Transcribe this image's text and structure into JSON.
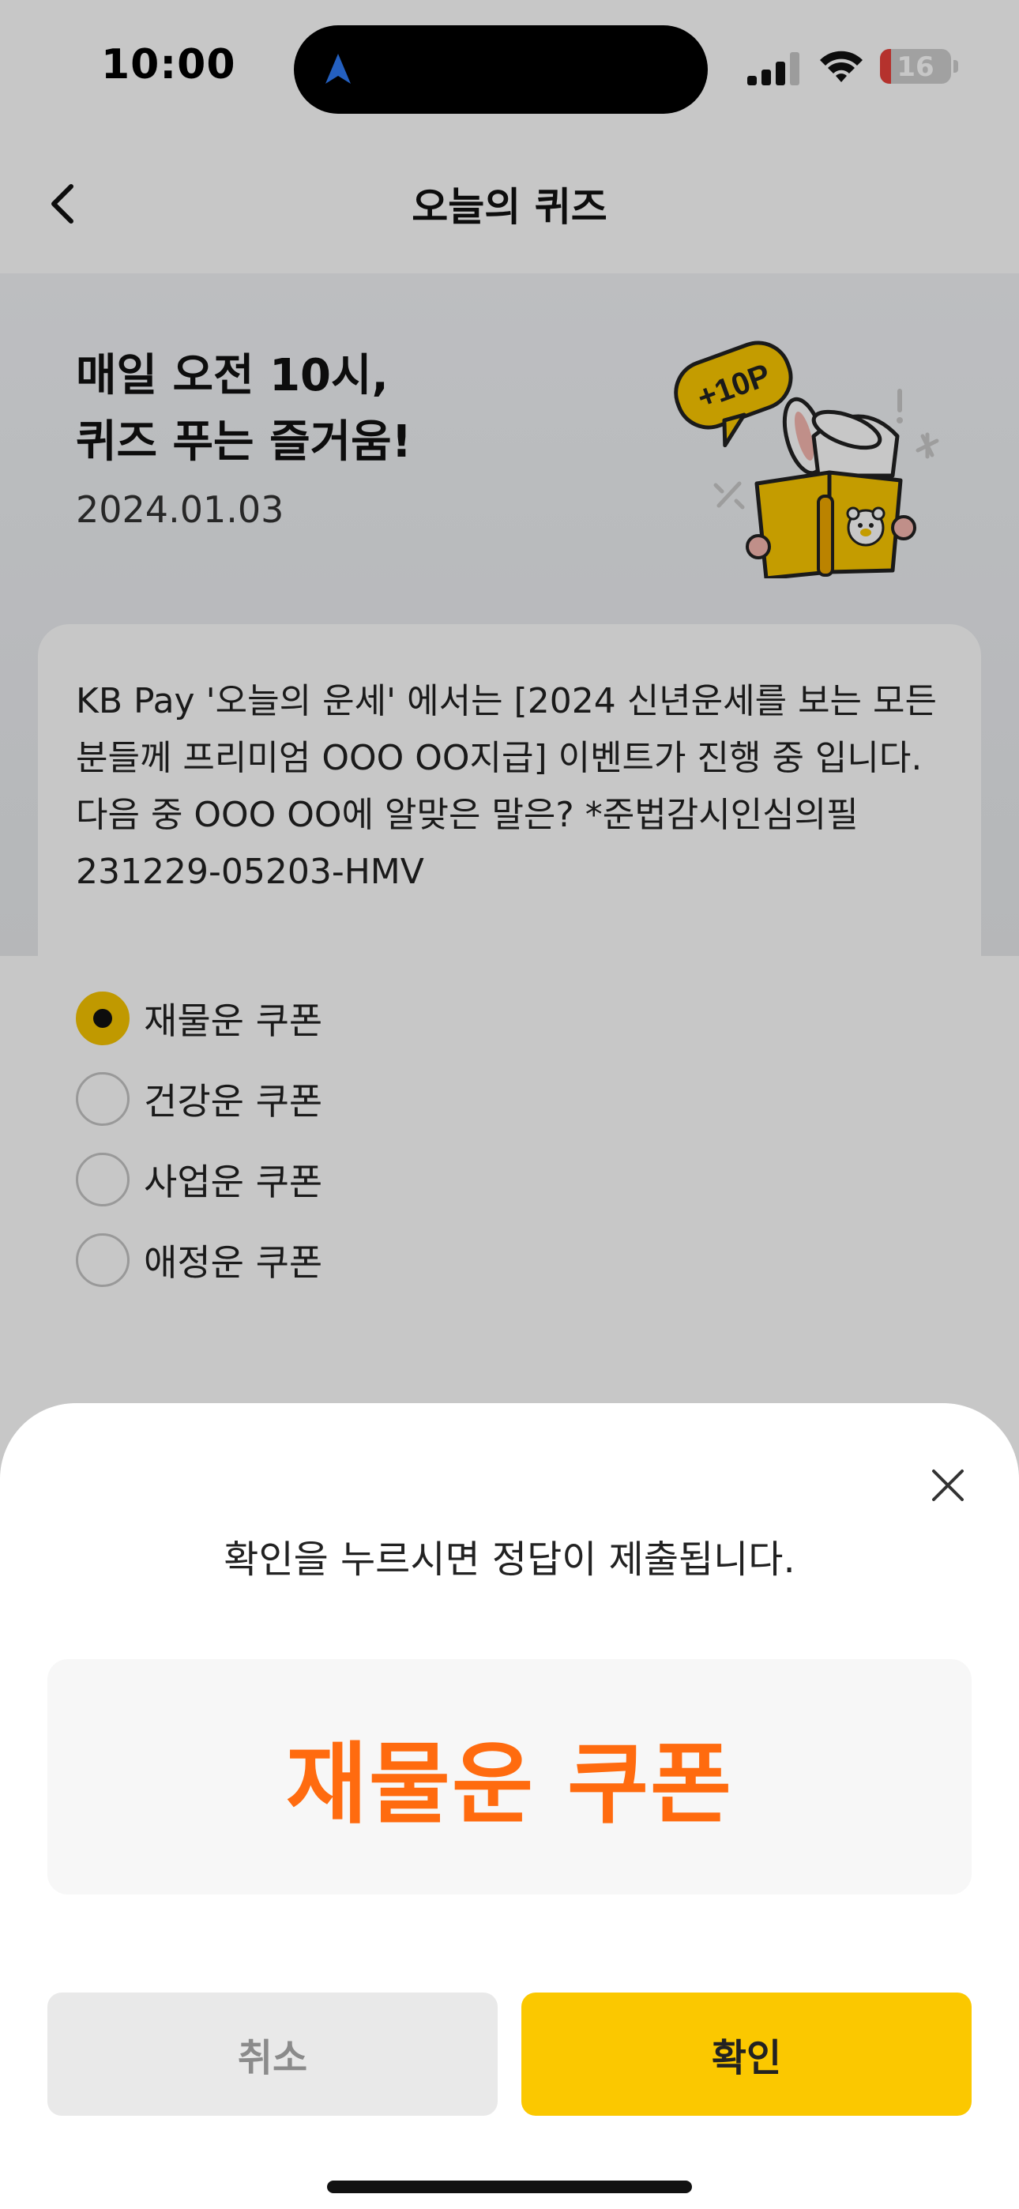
{
  "status_bar": {
    "time": "10:00",
    "battery": "16",
    "battery_level_percent": 16
  },
  "nav": {
    "title": "오늘의 퀴즈",
    "back_icon": "chevron-left-icon"
  },
  "hero": {
    "title_line1": "매일 오전 10시,",
    "title_line2": "퀴즈 푸는 즐거움!",
    "date": "2024.01.03",
    "badge": "+10P"
  },
  "quiz": {
    "question": "KB Pay '오늘의 운세' 에서는 [2024 신년운세를 보는 모든 분들께 프리미엄 OOO OO지급] 이벤트가 진행 중 입니다. 다음 중 OOO OO에 알맞은 말은? *준법감시인심의필 231229-05203-HMV",
    "options": [
      {
        "label": "재물운 쿠폰",
        "selected": true
      },
      {
        "label": "건강운 쿠폰",
        "selected": false
      },
      {
        "label": "사업운 쿠폰",
        "selected": false
      },
      {
        "label": "애정운 쿠폰",
        "selected": false
      }
    ]
  },
  "sheet": {
    "message": "확인을 누르시면 정답이 제출됩니다.",
    "selected_answer": "재물운 쿠폰",
    "cancel_label": "취소",
    "confirm_label": "확인"
  },
  "colors": {
    "accent_yellow": "#fbc800",
    "answer_orange": "#ff6b0f",
    "cancel_bg": "#e9e9e9"
  }
}
